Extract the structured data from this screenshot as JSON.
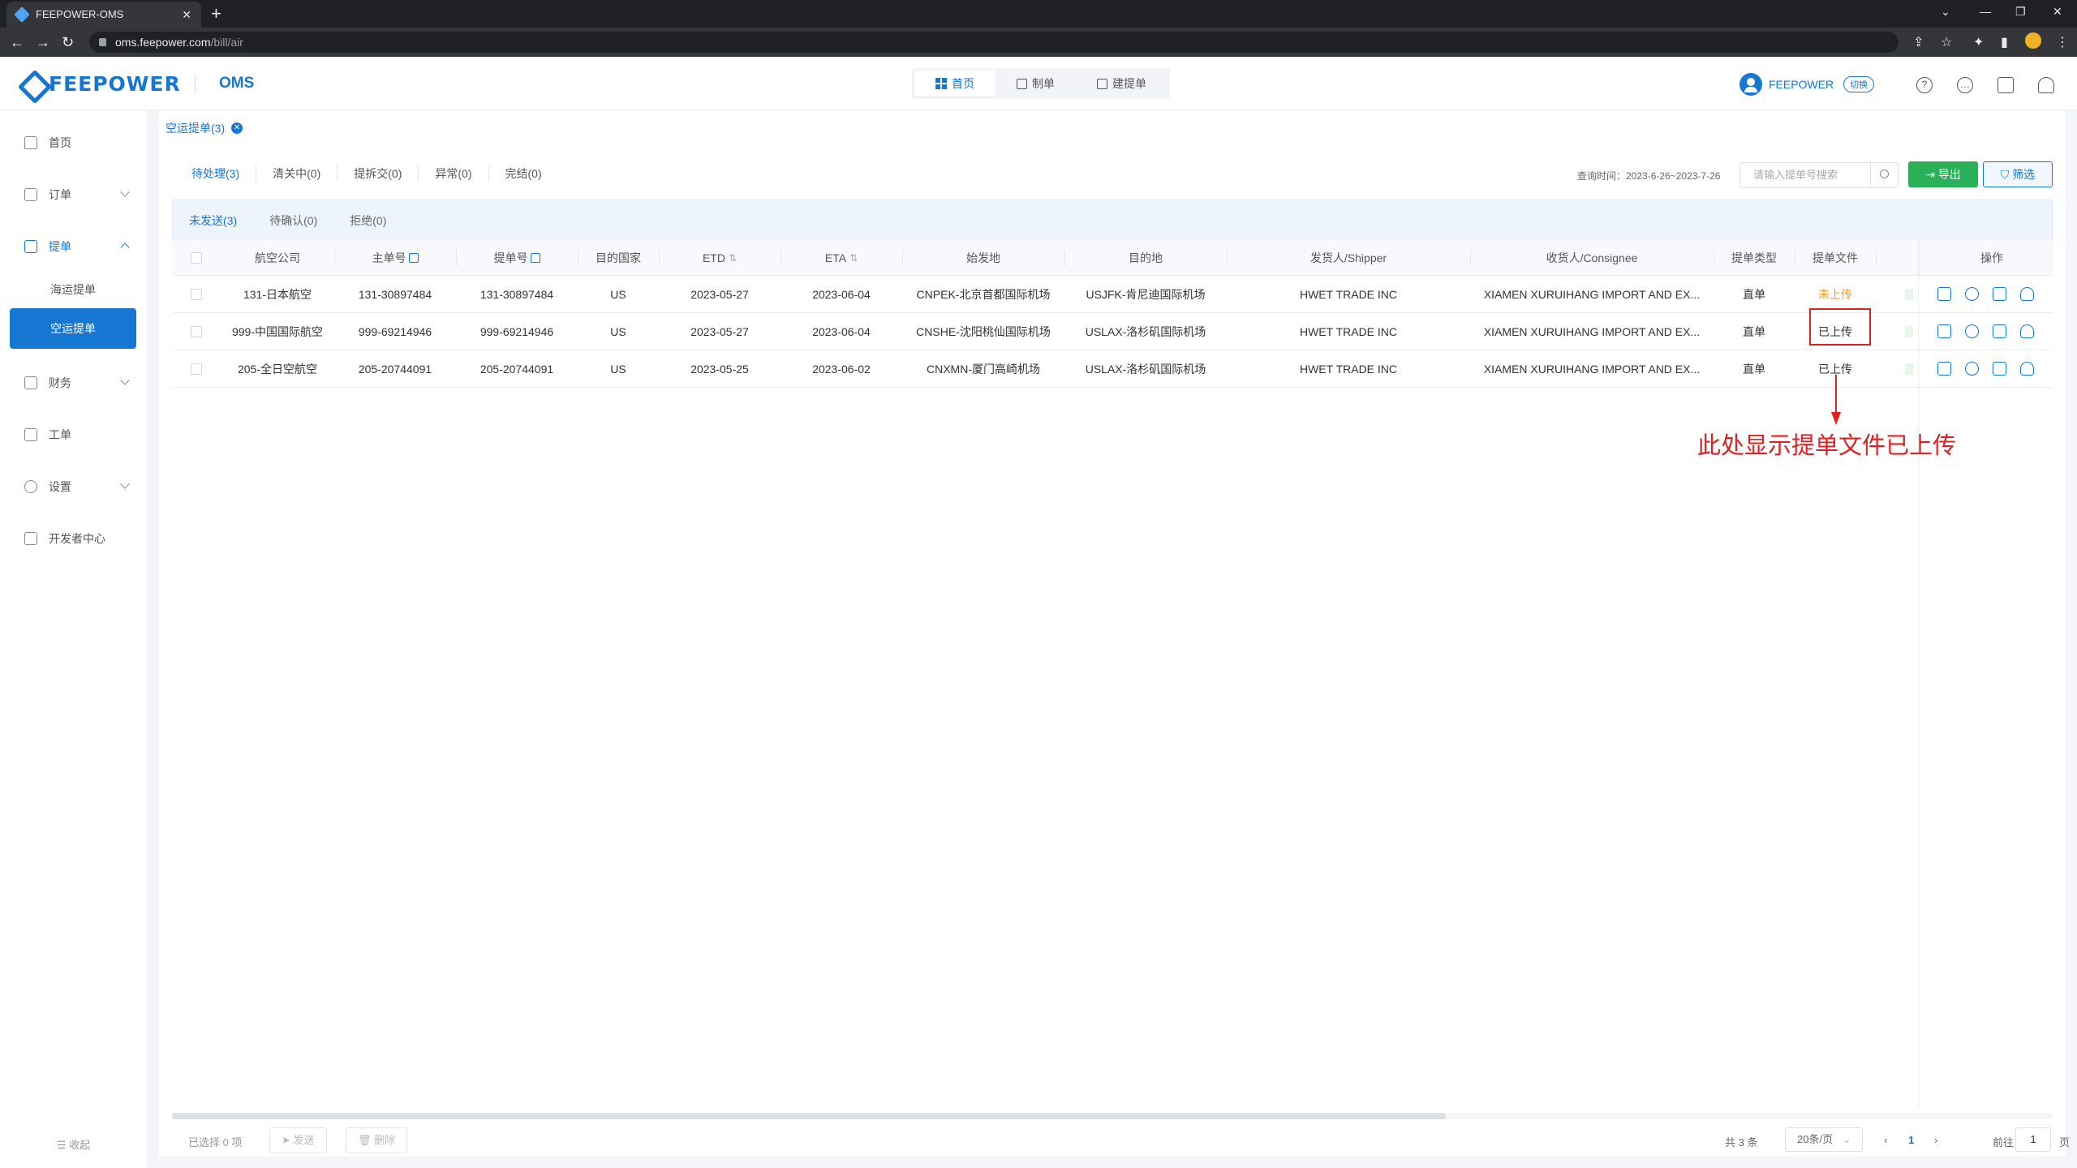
{
  "browser": {
    "tab_title": "FEEPOWER-OMS",
    "url_host": "oms.feepower.com",
    "url_path": "/bill/air"
  },
  "header": {
    "logo": "FEEPOWER",
    "product": "OMS",
    "nav": [
      {
        "label": "首页",
        "active": true
      },
      {
        "label": "制单",
        "active": false
      },
      {
        "label": "建提单",
        "active": false
      }
    ],
    "user": "FEEPOWER",
    "switch_label": "切换"
  },
  "sidebar": {
    "items": [
      {
        "label": "首页"
      },
      {
        "label": "订单"
      },
      {
        "label": "提单"
      },
      {
        "label": "财务"
      },
      {
        "label": "工单"
      },
      {
        "label": "设置"
      },
      {
        "label": "开发者中心"
      }
    ],
    "sub_items": [
      {
        "label": "海运提单",
        "active": false
      },
      {
        "label": "空运提单",
        "active": true
      }
    ],
    "collapse_label": "收起"
  },
  "breadcrumb": {
    "label": "空运提单(3)"
  },
  "status_tabs": [
    {
      "label": "待处理(3)",
      "active": true
    },
    {
      "label": "清关中(0)",
      "active": false
    },
    {
      "label": "提拆交(0)",
      "active": false
    },
    {
      "label": "异常(0)",
      "active": false
    },
    {
      "label": "完结(0)",
      "active": false
    }
  ],
  "query_time": "查询时间：2023-6-26~2023-7-26",
  "search": {
    "placeholder": "请输入提单号搜索"
  },
  "buttons": {
    "export": "导出",
    "filter": "筛选"
  },
  "sub_tabs": [
    {
      "label": "未发送(3)",
      "active": true
    },
    {
      "label": "待确认(0)",
      "active": false
    },
    {
      "label": "拒绝(0)",
      "active": false
    }
  ],
  "table": {
    "headers": [
      "航空公司",
      "主单号",
      "提单号",
      "目的国家",
      "ETD",
      "ETA",
      "始发地",
      "目的地",
      "发货人/Shipper",
      "收货人/Consignee",
      "提单类型",
      "提单文件",
      "操作"
    ],
    "rows": [
      {
        "airline": "131-日本航空",
        "master": "131-30897484",
        "bill": "131-30897484",
        "country": "US",
        "etd": "2023-05-27",
        "eta": "2023-06-04",
        "origin": "CNPEK-北京首都国际机场",
        "dest": "USJFK-肯尼迪国际机场",
        "shipper": "HWET TRADE INC",
        "consignee": "XIAMEN XURUIHANG IMPORT AND EX...",
        "type": "直单",
        "file": "未上传"
      },
      {
        "airline": "999-中国国际航空",
        "master": "999-69214946",
        "bill": "999-69214946",
        "country": "US",
        "etd": "2023-05-27",
        "eta": "2023-06-04",
        "origin": "CNSHE-沈阳桃仙国际机场",
        "dest": "USLAX-洛杉矶国际机场",
        "shipper": "HWET TRADE INC",
        "consignee": "XIAMEN XURUIHANG IMPORT AND EX...",
        "type": "直单",
        "file": "已上传"
      },
      {
        "airline": "205-全日空航空",
        "master": "205-20744091",
        "bill": "205-20744091",
        "country": "US",
        "etd": "2023-05-25",
        "eta": "2023-06-02",
        "origin": "CNXMN-厦门高崎机场",
        "dest": "USLAX-洛杉矶国际机场",
        "shipper": "HWET TRADE INC",
        "consignee": "XIAMEN XURUIHANG IMPORT AND EX...",
        "type": "直单",
        "file": "已上传"
      }
    ]
  },
  "annotation": "此处显示提单文件已上传",
  "footer": {
    "selected": "已选择 0 项",
    "send": "发送",
    "delete": "删除",
    "total": "共 3 条",
    "page_size": "20条/页",
    "current_page": "1",
    "goto_label": "前往",
    "goto_value": "1",
    "goto_suffix": "页"
  },
  "colors": {
    "primary": "#1677d2",
    "success": "#2bb05a",
    "warning": "#f59a23",
    "annotation": "#e02020"
  }
}
